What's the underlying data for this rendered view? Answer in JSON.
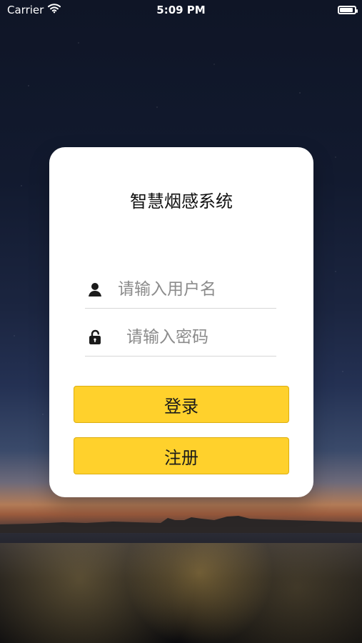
{
  "status_bar": {
    "carrier": "Carrier",
    "time": "5:09 PM",
    "battery_level": 0.9
  },
  "login_card": {
    "title": "智慧烟感系统",
    "username_placeholder": "请输入用户名",
    "password_placeholder": "请输入密码",
    "login_label": "登录",
    "register_label": "注册"
  },
  "theme": {
    "accent": "#ffd12c",
    "card_background": "#ffffff",
    "text_color": "#111111",
    "placeholder_color": "#8b8b8b"
  },
  "icons": {
    "wifi": "wifi-icon",
    "battery": "battery-icon",
    "user": "user-icon",
    "lock": "lock-open-icon"
  }
}
